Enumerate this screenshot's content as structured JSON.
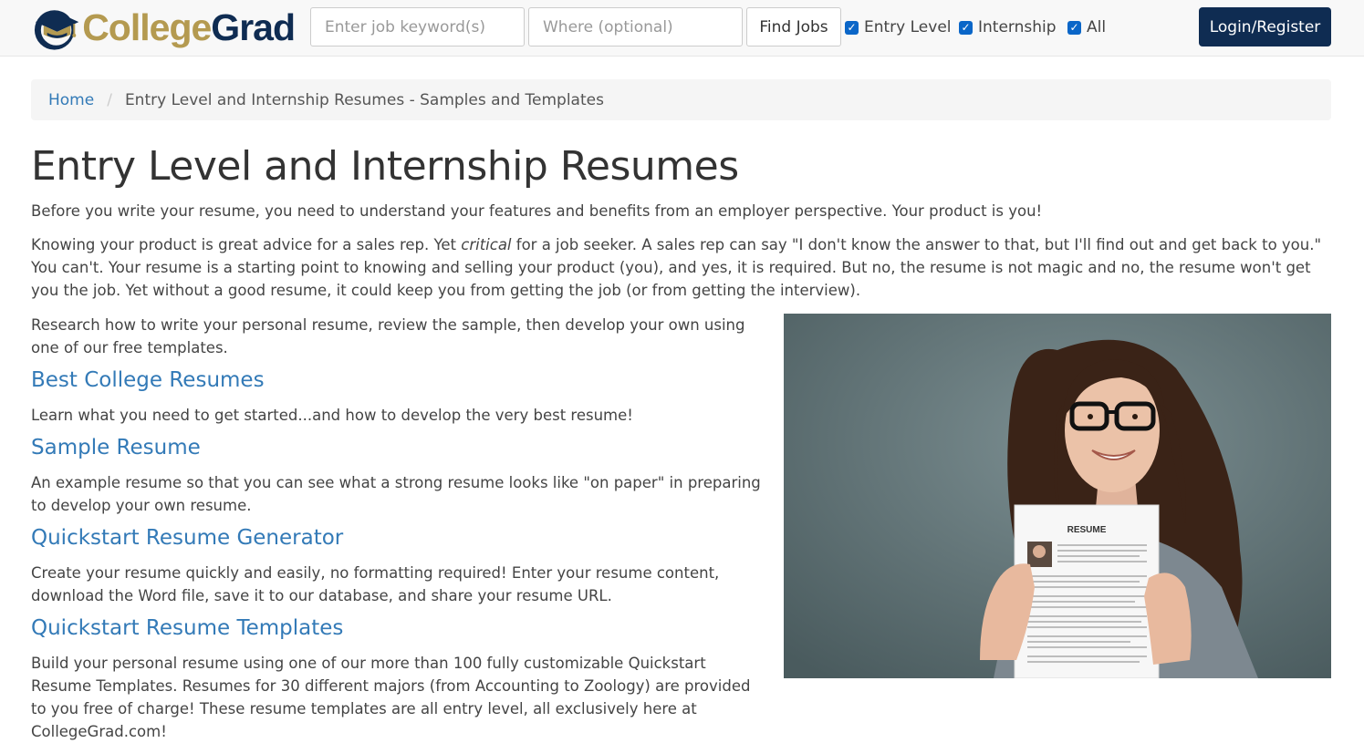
{
  "brand": {
    "college": "College",
    "grad": "Grad"
  },
  "search": {
    "keyword_placeholder": "Enter job keyword(s)",
    "where_placeholder": "Where (optional)",
    "find_label": "Find Jobs"
  },
  "filters": [
    {
      "label": "Entry Level",
      "checked": true
    },
    {
      "label": "Internship",
      "checked": true
    },
    {
      "label": "All",
      "checked": true
    }
  ],
  "login_label": "Login/Register",
  "breadcrumb": {
    "home": "Home",
    "separator": "/",
    "current": "Entry Level and Internship Resumes - Samples and Templates"
  },
  "page_title": "Entry Level and Internship Resumes",
  "intro": {
    "p1": "Before you write your resume, you need to understand your features and benefits from an employer perspective. Your product is you!",
    "p2_before": "Knowing your product is great advice for a sales rep. Yet ",
    "p2_em": "critical",
    "p2_after": " for a job seeker. A sales rep can say \"I don't know the answer to that, but I'll find out and get back to you.\" You can't. Your resume is a starting point to knowing and selling your product (you), and yes, it is required. But no, the resume is not magic and no, the resume won't get you the job. Yet without a good resume, it could keep you from getting the job (or from getting the interview).",
    "p3": "Research how to write your personal resume, review the sample, then develop your own using one of our free templates."
  },
  "sections": [
    {
      "title": "Best College Resumes",
      "desc": "Learn what you need to get started...and how to develop the very best resume!"
    },
    {
      "title": "Sample Resume",
      "desc": "An example resume so that you can see what a strong resume looks like \"on paper\" in preparing to develop your own resume."
    },
    {
      "title": "Quickstart Resume Generator",
      "desc": "Create your resume quickly and easily, no formatting required! Enter your resume content, download the Word file, save it to our database, and share your resume URL."
    },
    {
      "title": "Quickstart Resume Templates",
      "desc": "Build your personal resume using one of our more than 100 fully customizable Quickstart Resume Templates. Resumes for 30 different majors (from Accounting to Zoology) are provided to you free of charge! These resume templates are all entry level, all exclusively here at CollegeGrad.com!"
    }
  ],
  "photo": {
    "resume_heading": "RESUME"
  },
  "colors": {
    "navy": "#0f2c52",
    "gold": "#b49a50",
    "link": "#337ab7",
    "checkbox": "#0a66c8"
  }
}
